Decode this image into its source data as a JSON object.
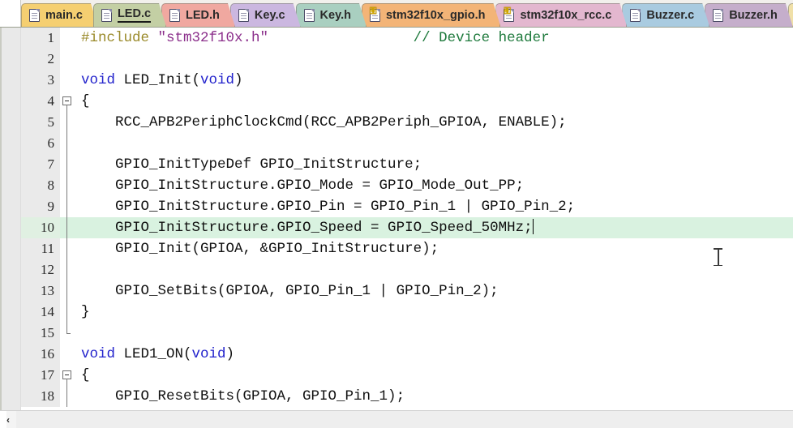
{
  "window": {
    "title": "LED.c",
    "colors": {
      "active_tab": "#c3cfa4",
      "highlight_line": "#d9f2e0",
      "gutter": "#eaeaea",
      "keyword": "#2222cc",
      "string": "#8b2f8b",
      "comment": "#1f7a3d",
      "preprocessor": "#9a8a2a"
    }
  },
  "tabbar": {
    "tabs": [
      {
        "label": "main.c",
        "icon": "file-icon",
        "color": "#f5cf71",
        "active": false
      },
      {
        "label": "LED.c",
        "icon": "file-icon",
        "color": "#c3cfa4",
        "active": true
      },
      {
        "label": "LED.h",
        "icon": "file-icon",
        "color": "#f0a8a0",
        "active": false
      },
      {
        "label": "Key.c",
        "icon": "file-icon",
        "color": "#cbb7e0",
        "active": false
      },
      {
        "label": "Key.h",
        "icon": "file-icon",
        "color": "#a9cfc0",
        "active": false
      },
      {
        "label": "stm32f10x_gpio.h",
        "icon": "file-key-icon",
        "color": "#f3b477",
        "active": false
      },
      {
        "label": "stm32f10x_rcc.c",
        "icon": "file-key-icon",
        "color": "#e3b7cf",
        "active": false
      },
      {
        "label": "Buzzer.c",
        "icon": "file-icon",
        "color": "#a9cbe0",
        "active": false
      },
      {
        "label": "Buzzer.h",
        "icon": "file-icon",
        "color": "#c5aecb",
        "active": false
      },
      {
        "label": "",
        "icon": "file-icon",
        "color": "#f0e0a8",
        "active": false
      }
    ]
  },
  "editor": {
    "lines": [
      {
        "num": "1",
        "fold": "none",
        "highlight": false,
        "tokens": [
          {
            "t": "#include ",
            "c": "pre"
          },
          {
            "t": "\"stm32f10x.h\"",
            "c": "str"
          },
          {
            "t": "                 ",
            "c": "txt"
          },
          {
            "t": "// Device header",
            "c": "com"
          }
        ]
      },
      {
        "num": "2",
        "fold": "none",
        "highlight": false,
        "tokens": []
      },
      {
        "num": "3",
        "fold": "none",
        "highlight": false,
        "tokens": [
          {
            "t": "void ",
            "c": "key"
          },
          {
            "t": "LED_Init(",
            "c": "txt"
          },
          {
            "t": "void",
            "c": "key"
          },
          {
            "t": ")",
            "c": "txt"
          }
        ]
      },
      {
        "num": "4",
        "fold": "box",
        "highlight": false,
        "tokens": [
          {
            "t": "{",
            "c": "txt"
          }
        ]
      },
      {
        "num": "5",
        "fold": "line",
        "highlight": false,
        "tokens": [
          {
            "t": "    RCC_APB2PeriphClockCmd(RCC_APB2Periph_GPIOA, ENABLE);",
            "c": "txt"
          }
        ]
      },
      {
        "num": "6",
        "fold": "line",
        "highlight": false,
        "tokens": []
      },
      {
        "num": "7",
        "fold": "line",
        "highlight": false,
        "tokens": [
          {
            "t": "    GPIO_InitTypeDef GPIO_InitStructure;",
            "c": "txt"
          }
        ]
      },
      {
        "num": "8",
        "fold": "line",
        "highlight": false,
        "tokens": [
          {
            "t": "    GPIO_InitStructure.GPIO_Mode = GPIO_Mode_Out_PP;",
            "c": "txt"
          }
        ]
      },
      {
        "num": "9",
        "fold": "line",
        "highlight": false,
        "tokens": [
          {
            "t": "    GPIO_InitStructure.GPIO_Pin = GPIO_Pin_1 | GPIO_Pin_2;",
            "c": "txt"
          }
        ]
      },
      {
        "num": "10",
        "fold": "line",
        "highlight": true,
        "caret": true,
        "tokens": [
          {
            "t": "    GPIO_InitStructure.GPIO_Speed = GPIO_Speed_50MHz;",
            "c": "txt"
          }
        ]
      },
      {
        "num": "11",
        "fold": "line",
        "highlight": false,
        "tokens": [
          {
            "t": "    GPIO_Init(GPIOA, &GPIO_InitStructure);",
            "c": "txt"
          }
        ]
      },
      {
        "num": "12",
        "fold": "line",
        "highlight": false,
        "tokens": []
      },
      {
        "num": "13",
        "fold": "line",
        "highlight": false,
        "tokens": [
          {
            "t": "    GPIO_SetBits(GPIOA, GPIO_Pin_1 | GPIO_Pin_2);",
            "c": "txt"
          }
        ]
      },
      {
        "num": "14",
        "fold": "line",
        "highlight": false,
        "tokens": [
          {
            "t": "}",
            "c": "txt"
          }
        ]
      },
      {
        "num": "15",
        "fold": "end",
        "highlight": false,
        "tokens": []
      },
      {
        "num": "16",
        "fold": "none",
        "highlight": false,
        "tokens": [
          {
            "t": "void ",
            "c": "key"
          },
          {
            "t": "LED1_ON(",
            "c": "txt"
          },
          {
            "t": "void",
            "c": "key"
          },
          {
            "t": ")",
            "c": "txt"
          }
        ]
      },
      {
        "num": "17",
        "fold": "box",
        "highlight": false,
        "tokens": [
          {
            "t": "{",
            "c": "txt"
          }
        ]
      },
      {
        "num": "18",
        "fold": "line",
        "highlight": false,
        "tokens": [
          {
            "t": "    GPIO_ResetBits(GPIOA, GPIO_Pin_1);",
            "c": "txt"
          }
        ]
      }
    ]
  },
  "scrollbar": {
    "left_arrow": "‹"
  }
}
